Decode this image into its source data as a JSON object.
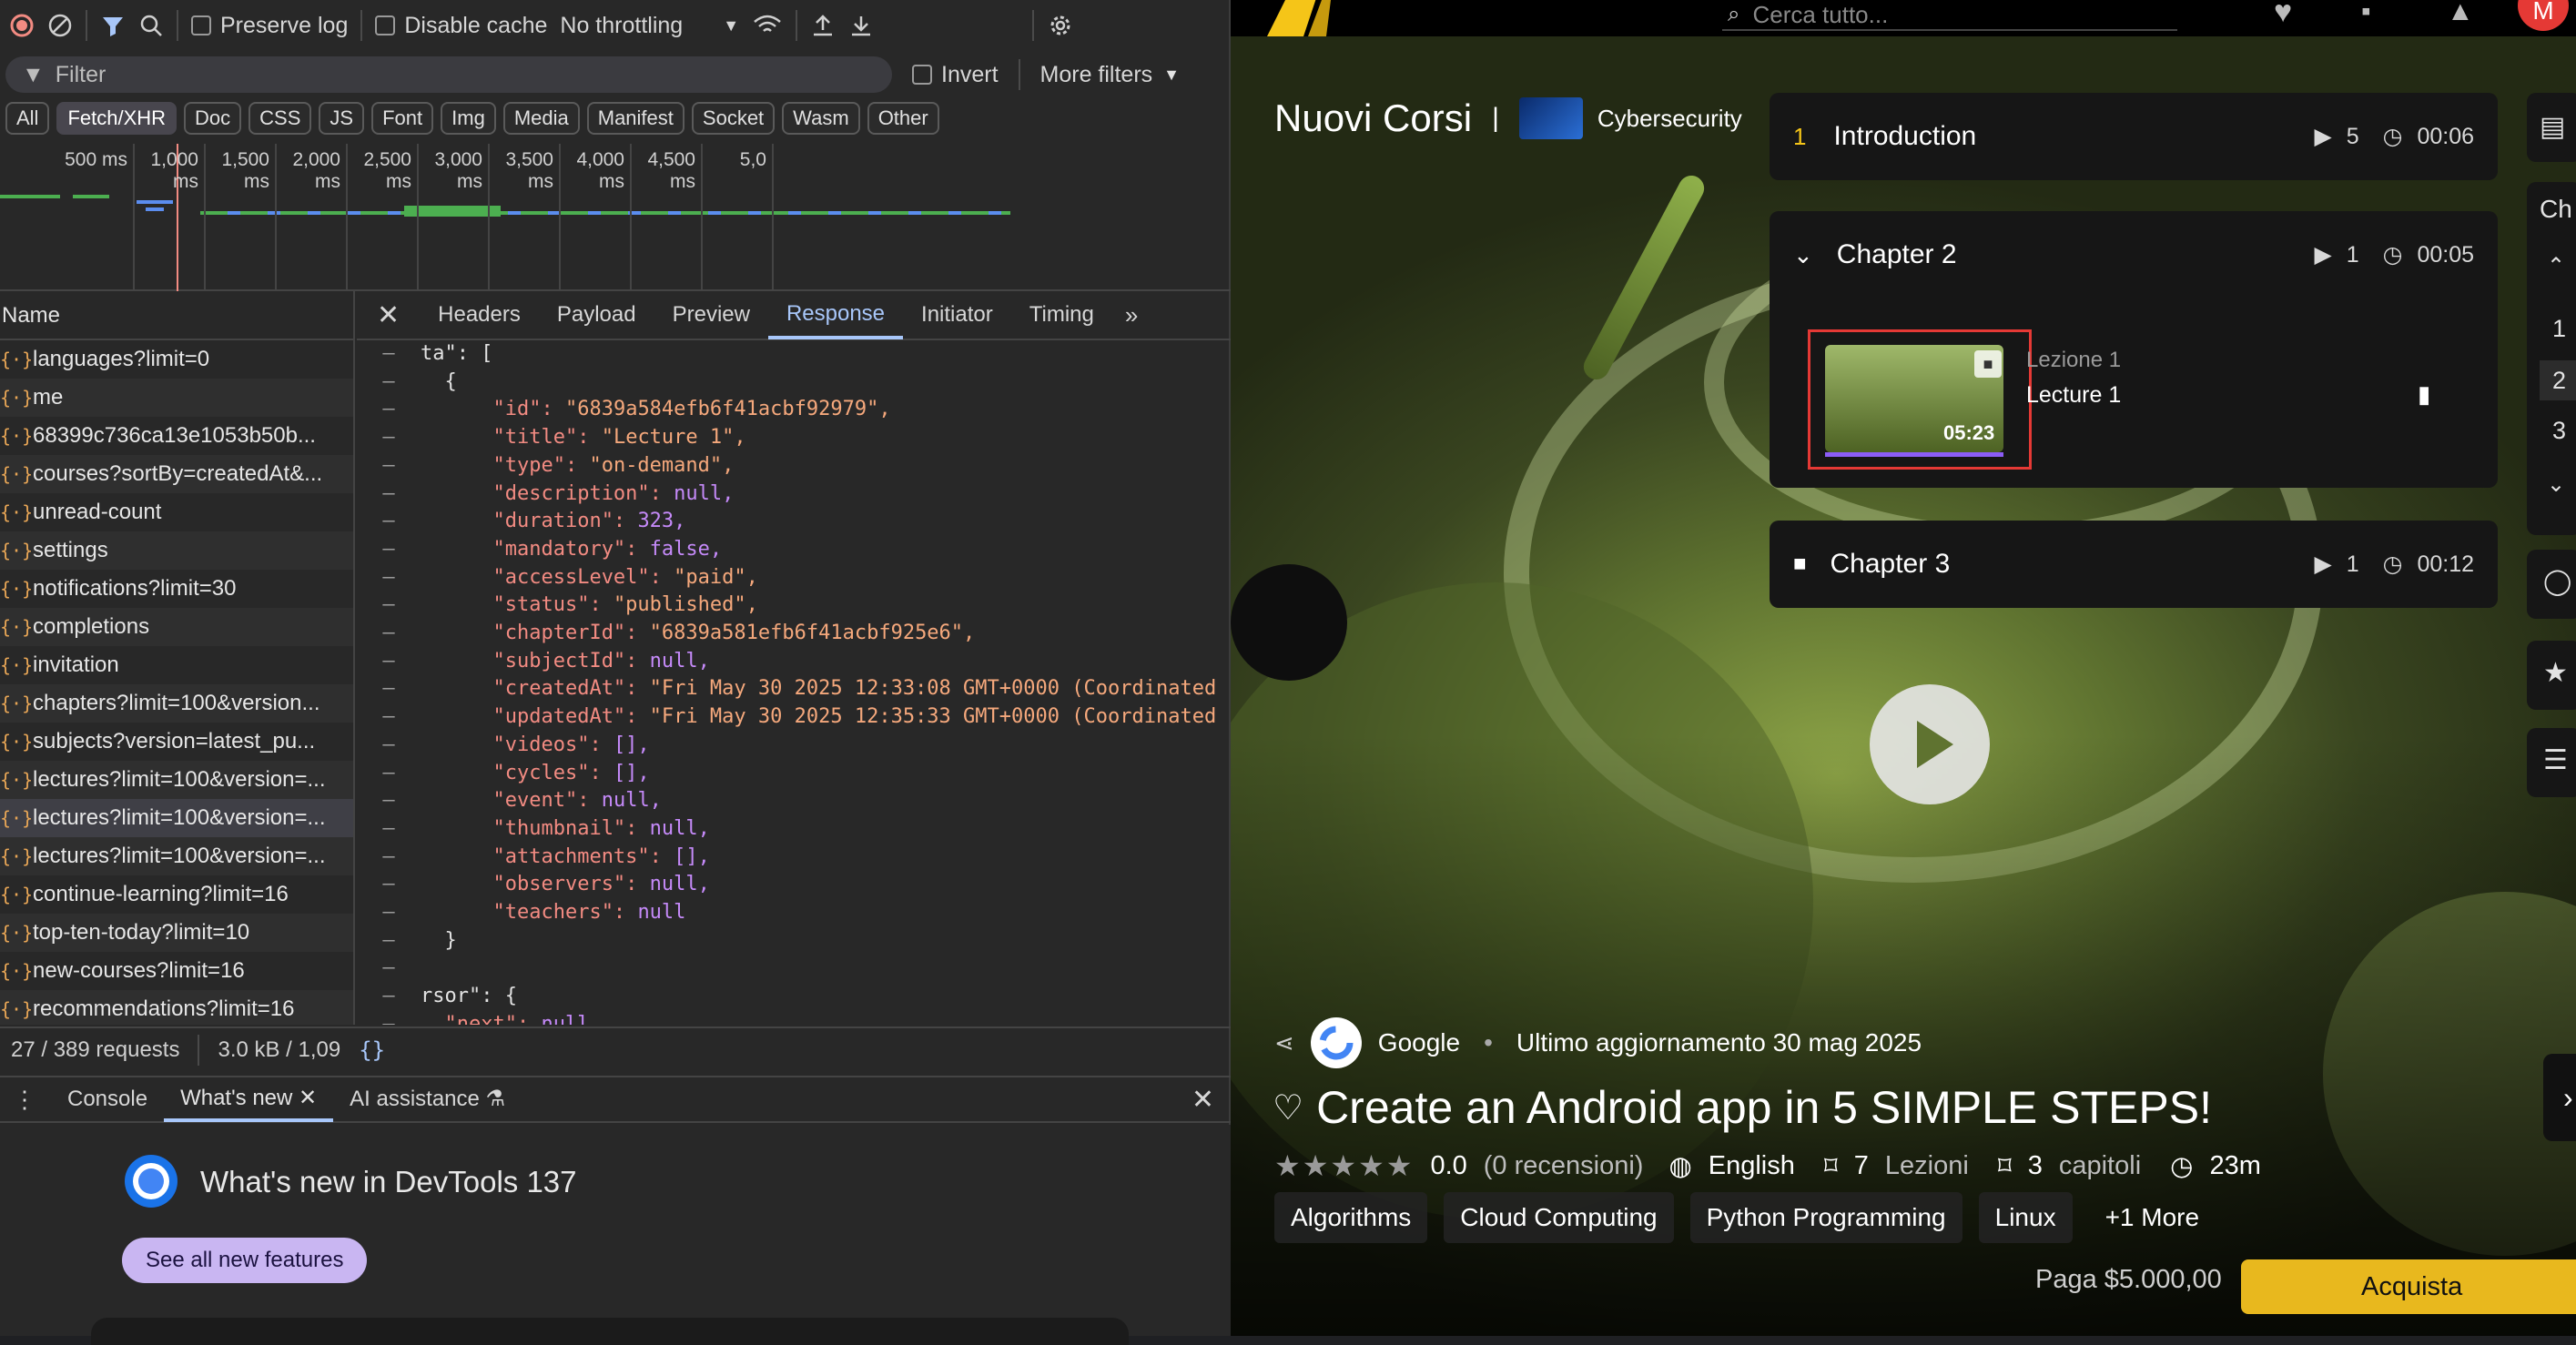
{
  "devtools": {
    "toolbar": {
      "preserve_log": "Preserve log",
      "disable_cache": "Disable cache",
      "throttling": "No throttling"
    },
    "filter": {
      "placeholder": "Filter",
      "invert": "Invert",
      "more_filters": "More filters"
    },
    "type_chips": [
      "All",
      "Fetch/XHR",
      "Doc",
      "CSS",
      "JS",
      "Font",
      "Img",
      "Media",
      "Manifest",
      "Socket",
      "Wasm",
      "Other"
    ],
    "timeline_ticks": [
      "500 ms",
      "1,000 ms",
      "1,500 ms",
      "2,000 ms",
      "2,500 ms",
      "3,000 ms",
      "3,500 ms",
      "4,000 ms",
      "4,500 ms",
      "5,0"
    ],
    "name_header": "Name",
    "requests": [
      "languages?limit=0",
      "me",
      "68399c736ca13e1053b50b...",
      "courses?sortBy=createdAt&...",
      "unread-count",
      "settings",
      "notifications?limit=30",
      "completions",
      "invitation",
      "chapters?limit=100&version...",
      "subjects?version=latest_pu...",
      "lectures?limit=100&version=...",
      "lectures?limit=100&version=...",
      "lectures?limit=100&version=...",
      "continue-learning?limit=16",
      "top-ten-today?limit=10",
      "new-courses?limit=16",
      "recommendations?limit=16"
    ],
    "detail_tabs": [
      "Headers",
      "Payload",
      "Preview",
      "Response",
      "Initiator",
      "Timing"
    ],
    "response_lines": [
      [
        "ta\": [",
        ""
      ],
      [
        "{",
        ""
      ],
      [
        "\"id\": ",
        "\"6839a584efb6f41acbf92979\","
      ],
      [
        "\"title\": ",
        "\"Lecture 1\","
      ],
      [
        "\"type\": ",
        "\"on-demand\","
      ],
      [
        "\"description\": ",
        "null,"
      ],
      [
        "\"duration\": ",
        "323,"
      ],
      [
        "\"mandatory\": ",
        "false,"
      ],
      [
        "\"accessLevel\": ",
        "\"paid\","
      ],
      [
        "\"status\": ",
        "\"published\","
      ],
      [
        "\"chapterId\": ",
        "\"6839a581efb6f41acbf925e6\","
      ],
      [
        "\"subjectId\": ",
        "null,"
      ],
      [
        "\"createdAt\": ",
        "\"Fri May 30 2025 12:33:08 GMT+0000 (Coordinated"
      ],
      [
        "\"updatedAt\": ",
        "\"Fri May 30 2025 12:35:33 GMT+0000 (Coordinated"
      ],
      [
        "\"videos\": ",
        "[],"
      ],
      [
        "\"cycles\": ",
        "[],"
      ],
      [
        "\"event\": ",
        "null,"
      ],
      [
        "\"thumbnail\": ",
        "null,"
      ],
      [
        "\"attachments\": ",
        "[],"
      ],
      [
        "\"observers\": ",
        "null,"
      ],
      [
        "\"teachers\": ",
        "null"
      ],
      [
        "}",
        ""
      ],
      [
        "",
        ""
      ],
      [
        "rsor\": {",
        ""
      ],
      [
        "\"next\": ",
        "null"
      ]
    ],
    "status_bar": {
      "requests": "27 / 389 requests",
      "size": "3.0 kB / 1,09"
    },
    "drawer_tabs": [
      "Console",
      "What's new",
      "AI assistance"
    ],
    "whats_new": {
      "title": "What's new in DevTools 137",
      "button": "See all new features"
    }
  },
  "app": {
    "search_placeholder": "Cerca tutto...",
    "section_title": "Nuovi Corsi",
    "category": "Cybersecurity",
    "chapters": [
      {
        "num": "1",
        "title": "Introduction",
        "lessons": "5",
        "duration": "00:06"
      },
      {
        "title": "Chapter 2",
        "lessons": "1",
        "duration": "00:05"
      },
      {
        "title": "Chapter 3",
        "lessons": "1",
        "duration": "00:12"
      }
    ],
    "lesson": {
      "label": "Lezione 1",
      "title": "Lecture 1",
      "duration": "05:23"
    },
    "side_nav": {
      "label": "Ch",
      "pages": [
        "1",
        "2",
        "3"
      ]
    },
    "course": {
      "author": "Google",
      "updated": "Ultimo aggiornamento 30 mag 2025",
      "title": "Create an Android app in 5 SIMPLE STEPS!",
      "rating": "0.0",
      "reviews": "(0 recensioni)",
      "language": "English",
      "lessons_count": "7",
      "lessons_label": "Lezioni",
      "chapters_count": "3",
      "chapters_label": "capitoli",
      "duration": "23m",
      "tags": [
        "Algorithms",
        "Cloud Computing",
        "Python Programming",
        "Linux",
        "+1 More"
      ],
      "price": "Paga $5.000,00",
      "buy": "Acquista"
    },
    "colors": {
      "accent": "#f5c518",
      "buy": "#e8b81e",
      "progress": "#8b5cf6"
    }
  }
}
